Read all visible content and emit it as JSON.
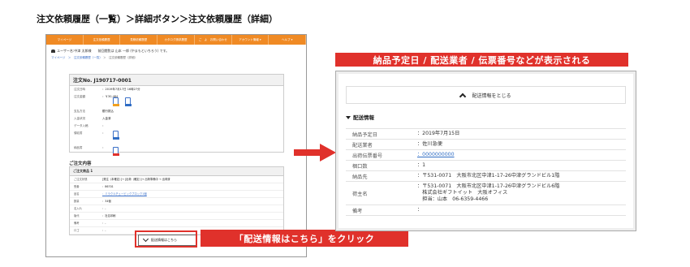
{
  "heading": "注文依頼履歴（一覧）＞詳細ボタン＞注文依頼履歴（詳細）",
  "left": {
    "nav": [
      "マイページ",
      "注文依頼履歴",
      "見積依頼履歴",
      "カタログ請求履歴",
      "ご　よ　お問い合わせ",
      "アカウント情報 ▾",
      "ヘルプ ▾"
    ],
    "greeting": "ユーザー名:中津 太郎様　　前回閲覧は 山本 一郎 (やまもといちろう) です。",
    "breadcrumb_links": "マイページ　＞　注文依頼履歴（一覧）",
    "breadcrumb_current": "＞　注文依頼履歴（詳細）",
    "order_title": "注文No. J190717-0001",
    "order_rows": [
      {
        "k": "注文日時",
        "v": "：2019年7月17日 16時27分"
      },
      {
        "k": "注文金額",
        "v": "：￥30,484"
      },
      {
        "k": "",
        "v": ""
      },
      {
        "k": "支払方法",
        "v": "銀行振込"
      },
      {
        "k": "入金状況",
        "v": "入金済"
      },
      {
        "k": "データ入稿",
        "v": "："
      },
      {
        "k": "領収書",
        "v": "："
      },
      {
        "k": "",
        "v": ""
      },
      {
        "k": "納品書",
        "v": "："
      }
    ],
    "content_head": "ご注文内容",
    "content_sub": "ご注文商品 1",
    "content_rows": [
      {
        "k": "ご注文状態",
        "v": "[発注（本確定）]→ [出荷（確定）]→ 出荷準備中 → 出荷済",
        "link": false
      },
      {
        "k": "受番",
        "v": "：86701",
        "link": false
      },
      {
        "k": "品名",
        "v": "：ミラクルチュービックブロック1個",
        "link": true
      },
      {
        "k": "数量",
        "v": "：34個",
        "link": false
      },
      {
        "k": "名入れ",
        "v": "：-",
        "link": false
      },
      {
        "k": "版代",
        "v": "：社名印刷",
        "link": false
      },
      {
        "k": "備考",
        "v": "：-",
        "link": false
      },
      {
        "k": "ロゴ",
        "v": "：-",
        "link": false
      }
    ],
    "shipping_button": "配送情報はこちら"
  },
  "callout_bottom": "「配送情報はこちら」をクリック",
  "callout_top": "納品予定日 / 配送業者 / 伝票番号などが表示される",
  "right": {
    "toggle_label": "配送情報をとじる",
    "section_title": "配送情報",
    "rows": [
      {
        "k": "納品予定日",
        "v": "：2019年7月15日",
        "link": false
      },
      {
        "k": "配送業者",
        "v": "：佐川急便",
        "link": false
      },
      {
        "k": "出荷伝票番号",
        "v": "：0000000000",
        "link": true
      },
      {
        "k": "梱口数",
        "v": "：1",
        "link": false
      },
      {
        "k": "納品先",
        "v": "：〒531-0071　大阪市北区中津1-17-26中津グランドビル1階",
        "link": false
      },
      {
        "k": "荷主名",
        "v": "：〒531-0071　大阪市北区中津1-17-26中津グランドビル6階\n　株式会社ギフトイット　大阪オフィス\n　担当：山本　06-6359-4466",
        "link": false
      },
      {
        "k": "備考",
        "v": "：",
        "link": false
      }
    ]
  },
  "colors": {
    "accent_red": "#e0312b",
    "nav_orange": "#f08a24",
    "link_blue": "#2f6dc4"
  }
}
